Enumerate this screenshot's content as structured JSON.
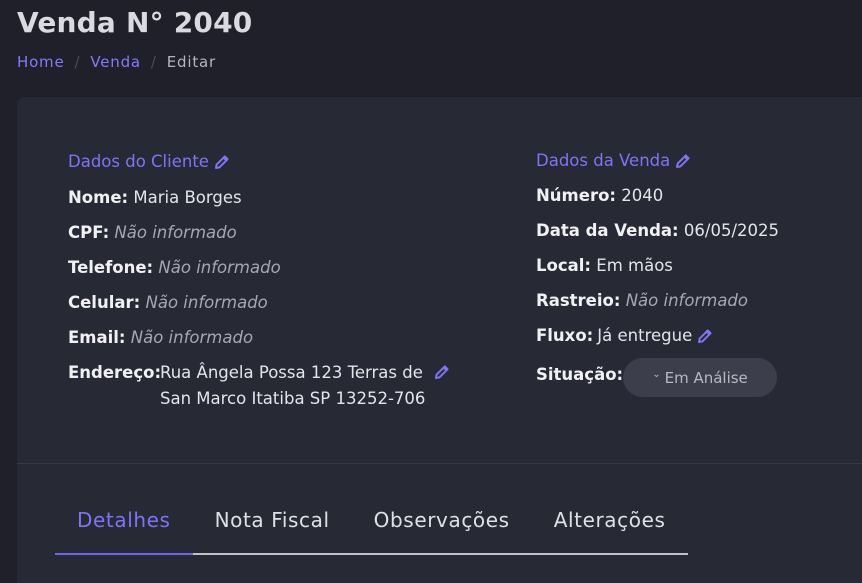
{
  "page": {
    "title": "Venda N° 2040"
  },
  "breadcrumb": {
    "home": "Home",
    "venda": "Venda",
    "separator": "/",
    "current": "Editar"
  },
  "cliente": {
    "title": "Dados do Cliente",
    "nome_label": "Nome:",
    "nome_value": "Maria Borges",
    "cpf_label": "CPF:",
    "cpf_value": "Não informado",
    "telefone_label": "Telefone:",
    "telefone_value": "Não informado",
    "celular_label": "Celular:",
    "celular_value": "Não informado",
    "email_label": "Email:",
    "email_value": "Não informado",
    "endereco_label": "Endereço:",
    "endereco_line1": "Rua Ângela Possa 123 Terras de",
    "endereco_line2": "San Marco Itatiba SP 13252-706"
  },
  "venda": {
    "title": "Dados da Venda",
    "numero_label": "Número:",
    "numero_value": "2040",
    "data_label": "Data da Venda:",
    "data_value": "06/05/2025",
    "local_label": "Local:",
    "local_value": "Em mãos",
    "rastreio_label": "Rastreio:",
    "rastreio_value": "Não informado",
    "fluxo_label": "Fluxo:",
    "fluxo_value": "Já entregue",
    "situacao_label": "Situação:",
    "situacao_value": "Em Análise"
  },
  "tabs": [
    {
      "label": "Detalhes",
      "active": true
    },
    {
      "label": "Nota Fiscal",
      "active": false
    },
    {
      "label": "Observações",
      "active": false
    },
    {
      "label": "Alterações",
      "active": false
    }
  ],
  "colors": {
    "accent": "#7e74f5",
    "background": "#1f2029",
    "card": "#272935",
    "chip": "#3c3e4b"
  },
  "icons": {
    "edit": "pencil-icon",
    "dropdown": "chevron-down-icon"
  }
}
